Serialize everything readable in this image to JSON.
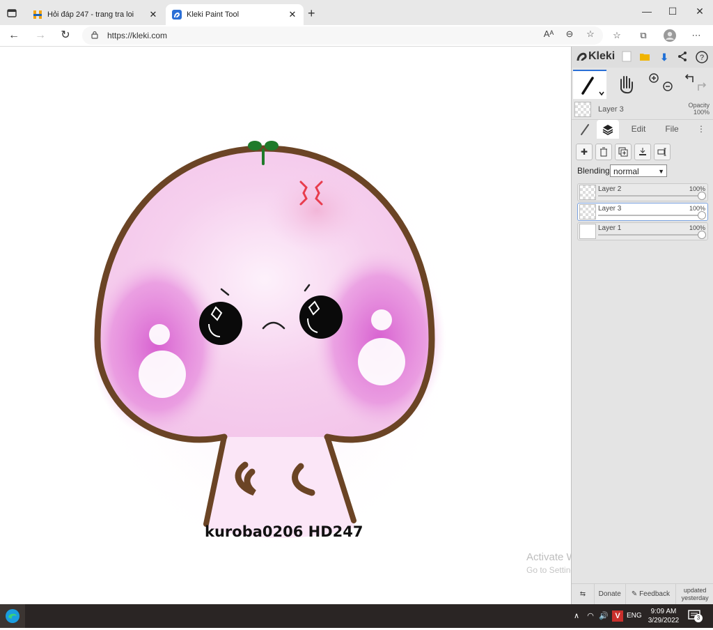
{
  "browser": {
    "tabs": [
      {
        "title": "Hỏi đáp 247 - trang tra loi",
        "active": false
      },
      {
        "title": "Kleki Paint Tool",
        "active": true
      }
    ],
    "url": "https://kleki.com"
  },
  "canvas": {
    "signature": "kuroba0206 HD247"
  },
  "watermark": {
    "line1": "Activate Windows",
    "line2": "Go to Settings to activate Windows."
  },
  "kleki": {
    "brand": "Kleki",
    "current_layer": {
      "name": "Layer 3",
      "opacity_label": "Opacity",
      "opacity_value": "100%"
    },
    "panel_tabs": {
      "edit": "Edit",
      "file": "File"
    },
    "blending_label": "Blending",
    "blending_value": "normal",
    "layers": [
      {
        "name": "Layer 2",
        "opacity": "100%",
        "selected": false
      },
      {
        "name": "Layer 3",
        "opacity": "100%",
        "selected": true
      },
      {
        "name": "Layer 1",
        "opacity": "100%",
        "selected": false
      }
    ],
    "footer": {
      "donate": "Donate",
      "feedback": "Feedback",
      "updated_1": "updated",
      "updated_2": "yesterday"
    }
  },
  "taskbar": {
    "language": "ENG",
    "time": "9:09 AM",
    "date": "3/29/2022",
    "notifications": "3"
  },
  "colors": {
    "accent": "#2b6fd6",
    "outline": "#6b4425",
    "blush": "#d35fcf",
    "sprout": "#1f7a2a"
  }
}
